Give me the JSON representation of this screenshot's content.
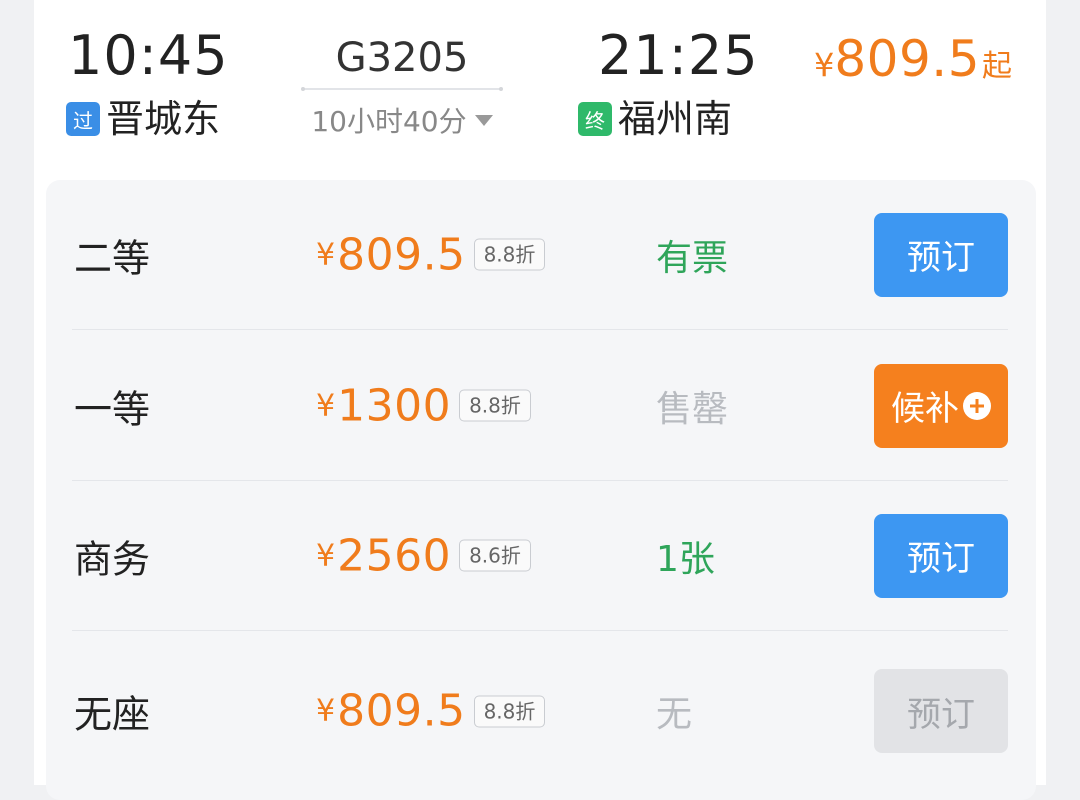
{
  "train": {
    "departure_time": "10:45",
    "departure_station": "晋城东",
    "departure_tag": "过",
    "train_number": "G3205",
    "duration": "10小时40分",
    "arrival_time": "21:25",
    "arrival_station": "福州南",
    "arrival_tag": "终",
    "min_price_symbol": "¥",
    "min_price": "809.5",
    "min_price_suffix": "起"
  },
  "seats": [
    {
      "name": "二等",
      "price_symbol": "¥",
      "price": "809.5",
      "discount": "8.8折",
      "availability": "有票",
      "button": "预订"
    },
    {
      "name": "一等",
      "price_symbol": "¥",
      "price": "1300",
      "discount": "8.8折",
      "availability": "售罄",
      "button": "候补"
    },
    {
      "name": "商务",
      "price_symbol": "¥",
      "price": "2560",
      "discount": "8.6折",
      "availability": "1张",
      "button": "预订"
    },
    {
      "name": "无座",
      "price_symbol": "¥",
      "price": "809.5",
      "discount": "8.8折",
      "availability": "无",
      "button": "预订"
    }
  ],
  "colors": {
    "price": "#f07c1c",
    "available": "#2fa55a",
    "sold_out": "#b8bbc0",
    "book_button": "#3d97f2",
    "waitlist_button": "#f5801e",
    "disabled_button": "#e2e3e6",
    "pass_tag": "#3a8ee6",
    "end_tag": "#2fb96a"
  },
  "icons": {
    "duration_toggle": "caret-down-icon",
    "waitlist_add": "plus-circle-icon"
  }
}
